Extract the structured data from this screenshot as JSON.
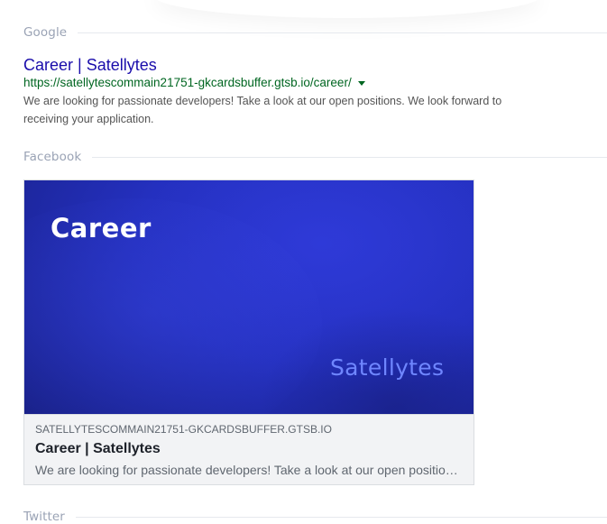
{
  "google": {
    "section_label": "Google",
    "title": "Career | Satellytes",
    "url": "https://satellytescommain21751-gkcardsbuffer.gtsb.io/career/",
    "description": "We are looking for passionate developers! Take a look at our open positions. We look forward to receiving your application.",
    "colors": {
      "title": "#1a0dab",
      "url": "#006621",
      "description": "#545454"
    }
  },
  "facebook": {
    "section_label": "Facebook",
    "image": {
      "title": "Career",
      "logo_text": "Satellytes",
      "colors": {
        "background": "#2430bf",
        "logo": "#6f86ff"
      }
    },
    "domain": "SATELLYTESCOMMAIN21751-GKCARDSBUFFER.GTSB.IO",
    "title": "Career | Satellytes",
    "description": "We are looking for passionate developers! Take a look at our open positions. We look forward to receiving your application."
  },
  "twitter": {
    "section_label": "Twitter"
  }
}
